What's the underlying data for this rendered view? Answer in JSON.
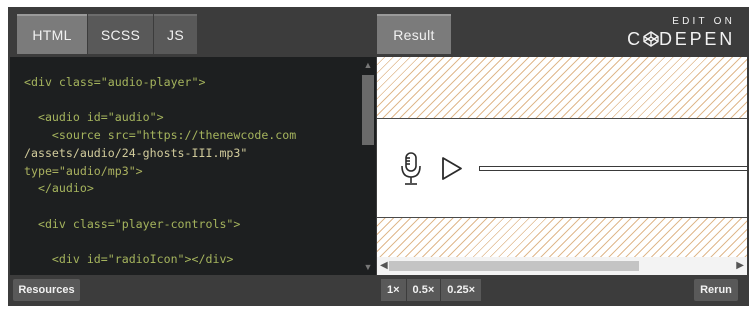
{
  "tabs": {
    "html": "HTML",
    "scss": "SCSS",
    "js": "JS",
    "result": "Result"
  },
  "brand": {
    "edit_on": "EDIT ON",
    "logo_left": "C",
    "logo_right": "DEPEN"
  },
  "code_lines": {
    "l1": "<div class=\"audio-player\">",
    "l2": "",
    "l3": "  <audio id=\"audio\">",
    "l4": "    <source src=\"https://thenewcode.com",
    "l5": "/assets/audio/24-ghosts-III.mp3\"",
    "l6": "type=\"audio/mp3\">",
    "l7": "  </audio>",
    "l8": "",
    "l9": "  <div class=\"player-controls\">",
    "l10": "",
    "l11": "    <div id=\"radioIcon\"></div>"
  },
  "result": {
    "mic_icon": "microphone-icon",
    "play_icon": "play-icon",
    "progress": 0
  },
  "footer": {
    "resources": "Resources",
    "zoom": [
      "1×",
      "0.5×",
      "0.25×"
    ],
    "rerun": "Rerun"
  },
  "colors": {
    "chrome": "#3c3c3c",
    "tab": "#595959",
    "tab_active": "#7b7b7b",
    "code_bg": "#1d1f20",
    "stripe": "#e0b98e"
  }
}
